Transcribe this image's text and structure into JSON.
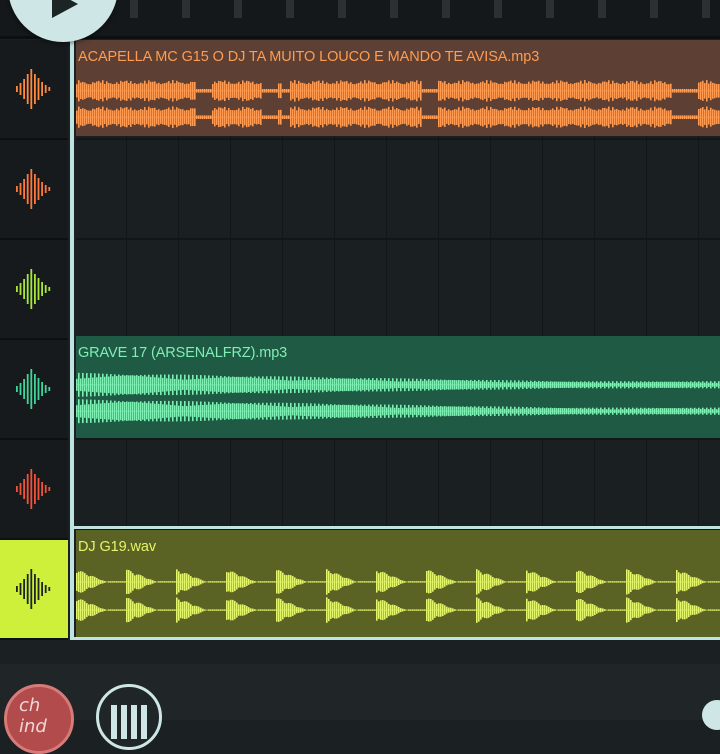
{
  "app": {
    "transport": {
      "play_icon": "play-icon"
    },
    "bottom_bar": {
      "record_label": "ch ind",
      "record_icon": "record-icon",
      "piano_icon": "piano-keys-icon"
    }
  },
  "tracks": [
    {
      "color": "#ff8a3d",
      "icon": "audio-waveform-icon",
      "selected": false
    },
    {
      "color": "#ff7a3a",
      "icon": "audio-waveform-icon",
      "selected": false
    },
    {
      "color": "#a8e63b",
      "icon": "audio-waveform-icon",
      "selected": false
    },
    {
      "color": "#3fd69a",
      "icon": "audio-waveform-icon",
      "selected": false
    },
    {
      "color": "#f0533a",
      "icon": "audio-waveform-icon",
      "selected": false
    },
    {
      "color": "#1c2426",
      "icon": "audio-waveform-icon",
      "selected": true
    }
  ],
  "clips": [
    {
      "name": "ACAPELLA MC G15 O DJ TA MUITO LOUCO E MANDO TE AVISA.mp3",
      "color": "#ff9b52",
      "track": 1
    },
    {
      "name": "GRAVE 17 (ARSENALFRZ).mp3",
      "color": "#7ef0b4",
      "track": 4
    },
    {
      "name": "DJ G19.wav",
      "color": "#e3f56a",
      "track": 6
    }
  ]
}
